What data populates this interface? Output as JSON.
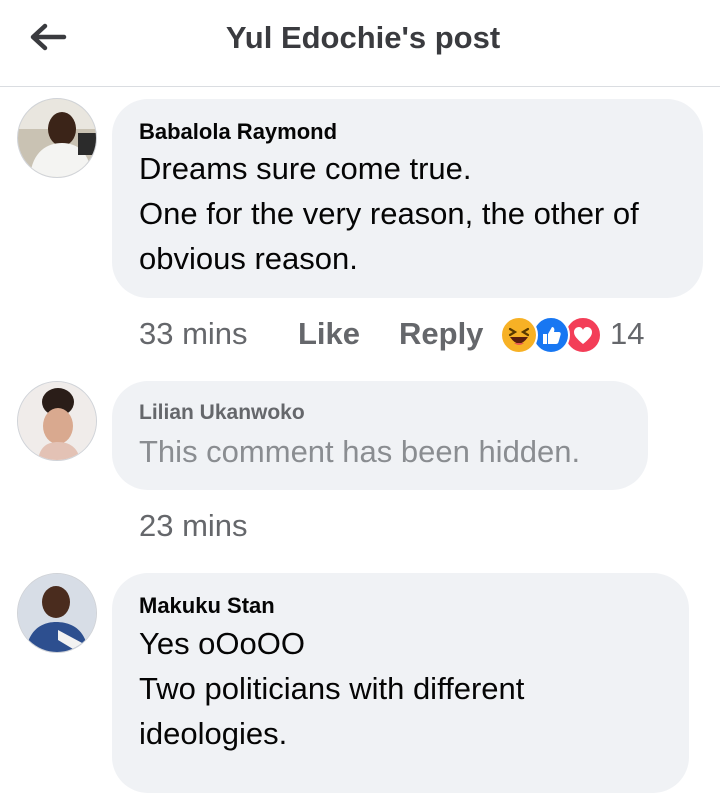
{
  "header": {
    "title": "Yul Edochie's post",
    "back_icon": "arrow-left-icon"
  },
  "comments": [
    {
      "author": "Babalola Raymond",
      "lines": [
        "Dreams sure come true.",
        "One for the very reason, the other of",
        "obvious reason."
      ],
      "time": "33 mins",
      "like_label": "Like",
      "reply_label": "Reply",
      "reactions": [
        "haha",
        "like",
        "love"
      ],
      "reaction_count": "14"
    },
    {
      "author": "Lilian Ukanwoko",
      "lines": [
        "This comment has been hidden."
      ],
      "time": "23 mins",
      "hidden": true
    },
    {
      "author": "Makuku Stan",
      "lines": [
        "Yes oOoOO",
        "Two politicians with different",
        "ideologies."
      ]
    }
  ],
  "colors": {
    "bubble": "#f0f2f5",
    "like_blue": "#1877f2",
    "love_red": "#f33e58",
    "haha_yellow": "#f7b125",
    "meta_gray": "#65676b"
  }
}
